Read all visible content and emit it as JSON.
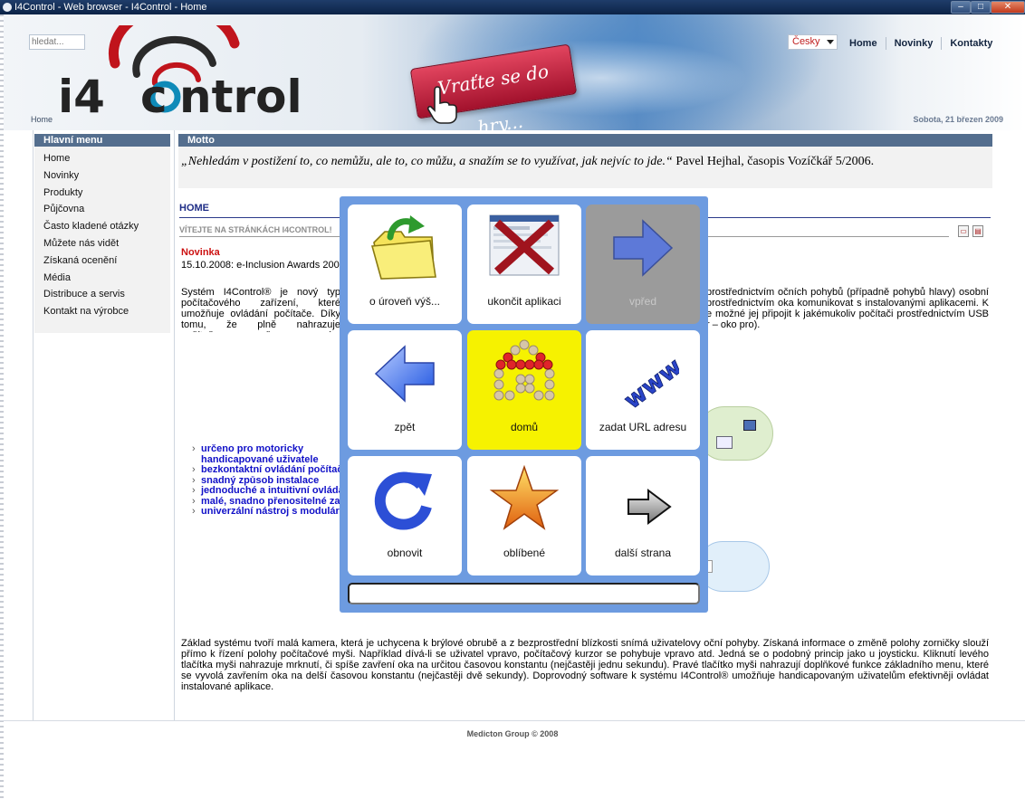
{
  "window": {
    "title": "I4Control - Web browser - I4Control - Home"
  },
  "header": {
    "search_placeholder": "hledat...",
    "logo_text": "I4CONTROL",
    "slogan": "Vraťte se do hry...",
    "language": "Česky",
    "nav": [
      "Home",
      "Novinky",
      "Kontakty"
    ],
    "breadcrumb": "Home",
    "date": "Sobota, 21 březen 2009"
  },
  "sidebar": {
    "title": "Hlavní menu",
    "items": [
      "Home",
      "Novinky",
      "Produkty",
      "Půjčovna",
      "Často kladené otázky",
      "Můžete nás vidět",
      "Získaná ocenění",
      "Média",
      "Distribuce a servis",
      "Kontakt na výrobce"
    ]
  },
  "motto": {
    "title": "Motto",
    "quote": "„Nehledám v postižení to, co nemůžu, ale to, co můžu, a snažím se to využívat, jak nejvíc to jde.“",
    "author": " Pavel Hejhal, časopis Vozíčkář 5/2006."
  },
  "content": {
    "heading": "HOME",
    "welcome": "VÍTEJTE NA STRÁNKÁCH I4CONTROL!",
    "news_label": "Novinka",
    "news_text": "15.10.2008: e-Inclusion Awards 200",
    "para1_left": "Systém I4Control® je nový typ počítačového zařízení, které umožňuje ovládání počítače. Díky tomu, že plně nahrazuje počítačovou myš, nesporným výhodám zařízení patří s rozhraní, a v neposlední řadě i nízká",
    "para1_right": "prostřednictvím očních pohybů (případně pohybů hlavy) osobní prostřednictvím oka komunikovat s instalovanými aplikacemi. K e možné jej připojit k jakémukoliv počítači prostřednictvím USB r – oko pro).",
    "bullets": [
      "určeno pro motoricky handicapované uživatele",
      "bezkontaktní ovládání počítače",
      "snadný způsob instalace",
      "jednoduché a intuitivní ovládání",
      "malé, snadno přenositelné zař",
      "univerzální nástroj s modulární"
    ],
    "para2": "Základ systému tvoří malá kamera, která je uchycena k brýlové obrubě a z bezprostřední blízkosti snímá uživatelovy oční pohyby. Získaná informace o změně polohy zorničky slouží přímo k řízení polohy počítačové myši. Například dívá-li se uživatel vpravo, počítačový kurzor se pohybuje vpravo atd. Jedná se o podobný princip jako u joysticku. Kliknutí levého tlačítka myši nahrazuje mrknutí, či spíše zavření oka na určitou časovou konstantu (nejčastěji jednu sekundu). Pravé tlačítko myši nahrazují doplňkové funkce základního menu, které se vyvolá zavřením oka na delší časovou konstantu (nejčastěji dvě sekundy). Doprovodný software k systému I4Control® umožňuje handicapovaným uživatelům efektivněji ovládat instalované aplikace."
  },
  "footer": {
    "text": "Medicton Group © 2008"
  },
  "overlay_menu": {
    "tiles": [
      {
        "label": "o úroveň výš...",
        "icon": "folder-up-icon",
        "state": "normal"
      },
      {
        "label": "ukončit aplikaci",
        "icon": "close-app-icon",
        "state": "normal"
      },
      {
        "label": "vpřed",
        "icon": "arrow-forward-icon",
        "state": "disabled"
      },
      {
        "label": "zpět",
        "icon": "arrow-back-icon",
        "state": "normal"
      },
      {
        "label": "domů",
        "icon": "home-icon",
        "state": "active"
      },
      {
        "label": "zadat URL adresu",
        "icon": "www-icon",
        "state": "normal"
      },
      {
        "label": "obnovit",
        "icon": "refresh-icon",
        "state": "normal"
      },
      {
        "label": "oblíbené",
        "icon": "favorites-star-icon",
        "state": "normal"
      },
      {
        "label": "další strana",
        "icon": "next-page-icon",
        "state": "normal"
      }
    ],
    "url_value": ""
  },
  "colors": {
    "menu_header": "#546e8e",
    "overlay_frame": "#6d9be0",
    "active_tile": "#f6f200",
    "disabled_tile": "#9b9b9b",
    "link_blue": "#1111c8",
    "news_red": "#cc1111"
  }
}
